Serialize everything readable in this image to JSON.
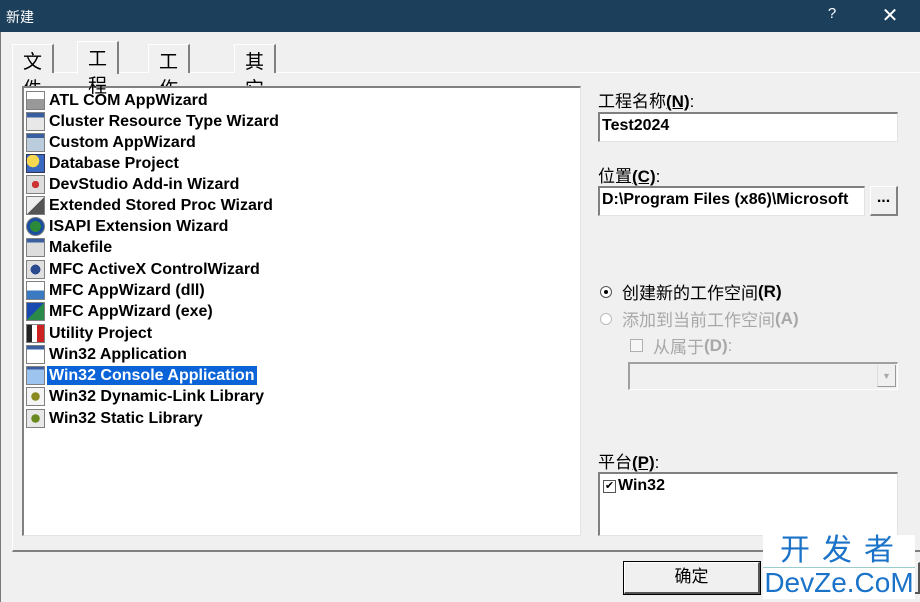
{
  "window": {
    "title": "新建",
    "help_label": "?",
    "close_label": "✕"
  },
  "tabs": [
    {
      "label": "文件",
      "active": false
    },
    {
      "label": "工程",
      "active": true
    },
    {
      "label": "工作区",
      "active": false
    },
    {
      "label": "其它文档",
      "active": false
    }
  ],
  "project_types": [
    {
      "label": "ATL COM AppWizard",
      "icon": "atl-wizard-icon"
    },
    {
      "label": "Cluster Resource Type Wizard",
      "icon": "cluster-wizard-icon"
    },
    {
      "label": "Custom AppWizard",
      "icon": "custom-wizard-icon"
    },
    {
      "label": "Database Project",
      "icon": "database-project-icon"
    },
    {
      "label": "DevStudio Add-in Wizard",
      "icon": "addin-wizard-icon"
    },
    {
      "label": "Extended Stored Proc Wizard",
      "icon": "stored-proc-wizard-icon"
    },
    {
      "label": "ISAPI Extension Wizard",
      "icon": "isapi-globe-icon"
    },
    {
      "label": "Makefile",
      "icon": "makefile-icon"
    },
    {
      "label": "MFC ActiveX ControlWizard",
      "icon": "activex-wizard-icon"
    },
    {
      "label": "MFC AppWizard (dll)",
      "icon": "mfc-dll-icon"
    },
    {
      "label": "MFC AppWizard (exe)",
      "icon": "mfc-exe-icon"
    },
    {
      "label": "Utility Project",
      "icon": "utility-tools-icon"
    },
    {
      "label": "Win32 Application",
      "icon": "win32-app-icon"
    },
    {
      "label": "Win32 Console Application",
      "icon": "console-window-icon",
      "selected": true
    },
    {
      "label": "Win32 Dynamic-Link Library",
      "icon": "dll-icon"
    },
    {
      "label": "Win32 Static Library",
      "icon": "static-lib-icon"
    }
  ],
  "project_name": {
    "label": "工程名称",
    "mnemonic": "(N)",
    "suffix": ":",
    "value": "Test2024"
  },
  "location": {
    "label": "位置",
    "mnemonic": "(C)",
    "suffix": ":",
    "value": "D:\\Program Files (x86)\\Microsoft",
    "browse_label": "..."
  },
  "workspace_options": {
    "create_new": {
      "label": "创建新的工作空间",
      "mnemonic": "(R)",
      "checked": true,
      "enabled": true
    },
    "add_to_current": {
      "label": "添加到当前工作空间",
      "mnemonic": "(A)",
      "checked": false,
      "enabled": false
    },
    "dependency": {
      "label": "从属于",
      "mnemonic": "(D)",
      "suffix": ":",
      "checked": false,
      "enabled": false
    },
    "dependency_value": ""
  },
  "platforms": {
    "label": "平台",
    "mnemonic": "(P)",
    "suffix": ":",
    "items": [
      {
        "label": "Win32",
        "checked": true,
        "check_glyph": "✔"
      }
    ]
  },
  "buttons": {
    "ok_label": "确定",
    "dropdown_arrow": "▼"
  },
  "watermark": {
    "line1": "开发者",
    "line2": "DevZe.CoM",
    "color": "#1a73c8"
  },
  "colors": {
    "titlebar": "#1c3f5b",
    "selection": "#0a64d8",
    "dialog_bg": "#f0f0f0"
  }
}
